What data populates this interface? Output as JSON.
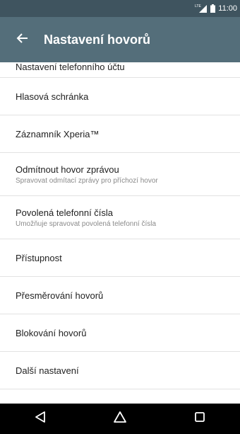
{
  "status_bar": {
    "time": "11:00",
    "network": "LTE"
  },
  "toolbar": {
    "title": "Nastavení hovorů"
  },
  "items": [
    {
      "title": "Nastavení telefonního účtu",
      "subtitle": ""
    },
    {
      "title": "Hlasová schránka",
      "subtitle": ""
    },
    {
      "title": "Záznamník Xperia™",
      "subtitle": ""
    },
    {
      "title": "Odmítnout hovor zprávou",
      "subtitle": "Spravovat odmítací zprávy pro příchozí hovor"
    },
    {
      "title": "Povolená telefonní čísla",
      "subtitle": "Umožňuje spravovat povolená telefonní čísla"
    },
    {
      "title": "Přístupnost",
      "subtitle": ""
    },
    {
      "title": "Přesměrování hovorů",
      "subtitle": ""
    },
    {
      "title": "Blokování hovorů",
      "subtitle": ""
    },
    {
      "title": "Další nastavení",
      "subtitle": ""
    }
  ],
  "colors": {
    "status_bar": "#3f545f",
    "toolbar": "#546e7a",
    "nav_bar": "#000000"
  },
  "icons": {
    "back": "arrow-left-icon",
    "nav": [
      "back-triangle-icon",
      "home-icon",
      "recents-icon"
    ]
  }
}
